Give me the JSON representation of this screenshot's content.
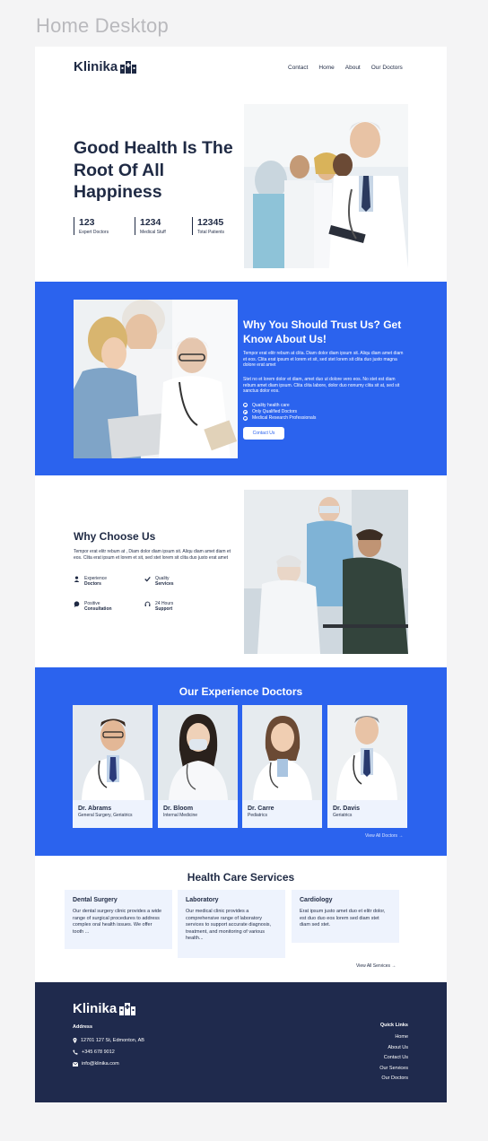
{
  "frame_label": "Home Desktop",
  "brand": {
    "name": "Klinika"
  },
  "nav": [
    "Contact",
    "Home",
    "About",
    "Our Doctors"
  ],
  "hero": {
    "title": "Good Health Is The Root Of All Happiness",
    "stats": [
      {
        "value": "123",
        "label": "Expert Doctors"
      },
      {
        "value": "1234",
        "label": "Medical Stuff"
      },
      {
        "value": "12345",
        "label": "Total Patients"
      }
    ]
  },
  "trust": {
    "title": "Why You Should Trust Us? Get Know About Us!",
    "para1": "Tempor erat elitr rebum at clita. Diam dolor diam ipsum sit. Aliqu diam amet diam et eos. Clita erat ipsum et lorem et sit, sed stet lorem sit clita duo justo magna dolore erat amet",
    "para2": "Stet no et lorem dolor et diam, amet duo ut dolore vero eos. No stet est diam rebum amet diam ipsum. Clita  clita labore, dolor duo nonumy clita sit at, sed sit sanctus dolor eos.",
    "checklist": [
      "Quality health care",
      "Only Qualified Doctors",
      "Medical Research Professionals"
    ],
    "button": "Contact Us"
  },
  "why": {
    "title": "Why Choose Us",
    "text": "Tempor erat elitr rebum at , Diam dolor diam ipsum sit. Aliqu diam amet diam et eos. Clita erat ipsum et lorem et sit, sed stet lorem sit clita duo justo erat amet",
    "features": [
      {
        "line1": "Experience",
        "line2": "Doctors",
        "icon": "user-icon"
      },
      {
        "line1": "Quality",
        "line2": "Services",
        "icon": "check-icon"
      },
      {
        "line1": "Positive",
        "line2": "Consultation",
        "icon": "chat-bubble-icon"
      },
      {
        "line1": "24 Hours",
        "line2": "Support",
        "icon": "headset-icon"
      }
    ]
  },
  "doctors": {
    "title": "Our Experience Doctors",
    "list": [
      {
        "name": "Dr. Abrams",
        "specialty": "General Surgery, Geriatrics"
      },
      {
        "name": "Dr. Bloom",
        "specialty": "Internal Medicine"
      },
      {
        "name": "Dr. Carre",
        "specialty": "Pediatrics"
      },
      {
        "name": "Dr. Davis",
        "specialty": "Geriatrics"
      }
    ],
    "view_all": "View All Doctors →"
  },
  "services": {
    "title": "Health Care Services",
    "list": [
      {
        "name": "Dental Surgery",
        "desc": "Our dental surgery clinic provides a wide range of surgical procedures to address complex oral health issues. We offer tooth ..."
      },
      {
        "name": "Laboratory",
        "desc": "Our medical clinic provides a comprehensive range of laboratory services to support accurate diagnosis, treatment, and monitoring of various health..."
      },
      {
        "name": "Cardiology",
        "desc": "Erat ipsum justo amet duo et elitr dolor, est duo duo eos lorem sed diam stet diam sed stet."
      }
    ],
    "view_all": "View All Services →"
  },
  "footer": {
    "address_heading": "Address",
    "address": "12701 127 St, Edmonton, AB",
    "phone": "+345 678 9012",
    "email": "info@klinika.com",
    "quick_links_heading": "Quick Links",
    "quick_links": [
      "Home",
      "About Us",
      "Contact Us",
      "Our Services",
      "Our Doctors"
    ]
  },
  "colors": {
    "primary": "#2b63ee",
    "navy": "#1f2a44",
    "footer": "#1f2a4d",
    "card": "#eef3fd"
  }
}
